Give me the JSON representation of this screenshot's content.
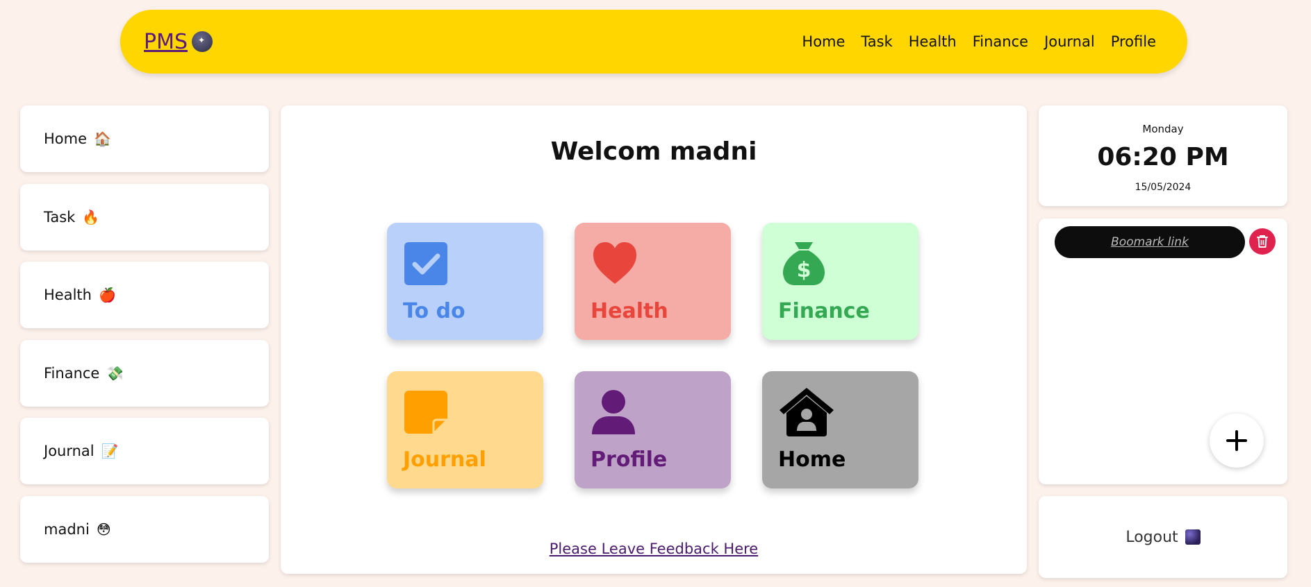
{
  "navbar": {
    "brand": "PMS",
    "brand_icon": "crystal-ball-icon",
    "links": [
      "Home",
      "Task",
      "Health",
      "Finance",
      "Journal",
      "Profile"
    ],
    "background": "#ffd600"
  },
  "sidebar": {
    "items": [
      {
        "label": "Home",
        "emoji": "🏠"
      },
      {
        "label": "Task",
        "emoji": "🔥"
      },
      {
        "label": "Health",
        "emoji": "🍎"
      },
      {
        "label": "Finance",
        "emoji": "💸"
      },
      {
        "label": "Journal",
        "emoji": "📝"
      },
      {
        "label": "madni",
        "emoji": "😳"
      }
    ]
  },
  "main": {
    "welcome": "Welcom madni",
    "tiles": [
      {
        "label": "To do",
        "icon": "checkbox-icon",
        "bg": "#b8d0fa",
        "color": "#4a86e8"
      },
      {
        "label": "Health",
        "icon": "heart-icon",
        "bg": "#f5aba6",
        "color": "#e8453c"
      },
      {
        "label": "Finance",
        "icon": "money-bag-icon",
        "bg": "#cfffd4",
        "color": "#34a853"
      },
      {
        "label": "Journal",
        "icon": "sticky-note-icon",
        "bg": "#ffd98e",
        "color": "#ffa000"
      },
      {
        "label": "Profile",
        "icon": "person-icon",
        "bg": "#bea2c8",
        "color": "#621b76"
      },
      {
        "label": "Home",
        "icon": "house-user-icon",
        "bg": "#a6a6a6",
        "color": "#000000"
      }
    ],
    "feedback": "Please Leave Feedback Here"
  },
  "clock": {
    "day": "Monday",
    "time": "06:20 PM",
    "date": "15/05/2024"
  },
  "bookmarks": {
    "items": [
      "Boomark link"
    ],
    "delete_icon": "trash-icon",
    "add_icon": "plus-icon"
  },
  "logout": {
    "label": "Logout",
    "icon": "galaxy-icon"
  }
}
